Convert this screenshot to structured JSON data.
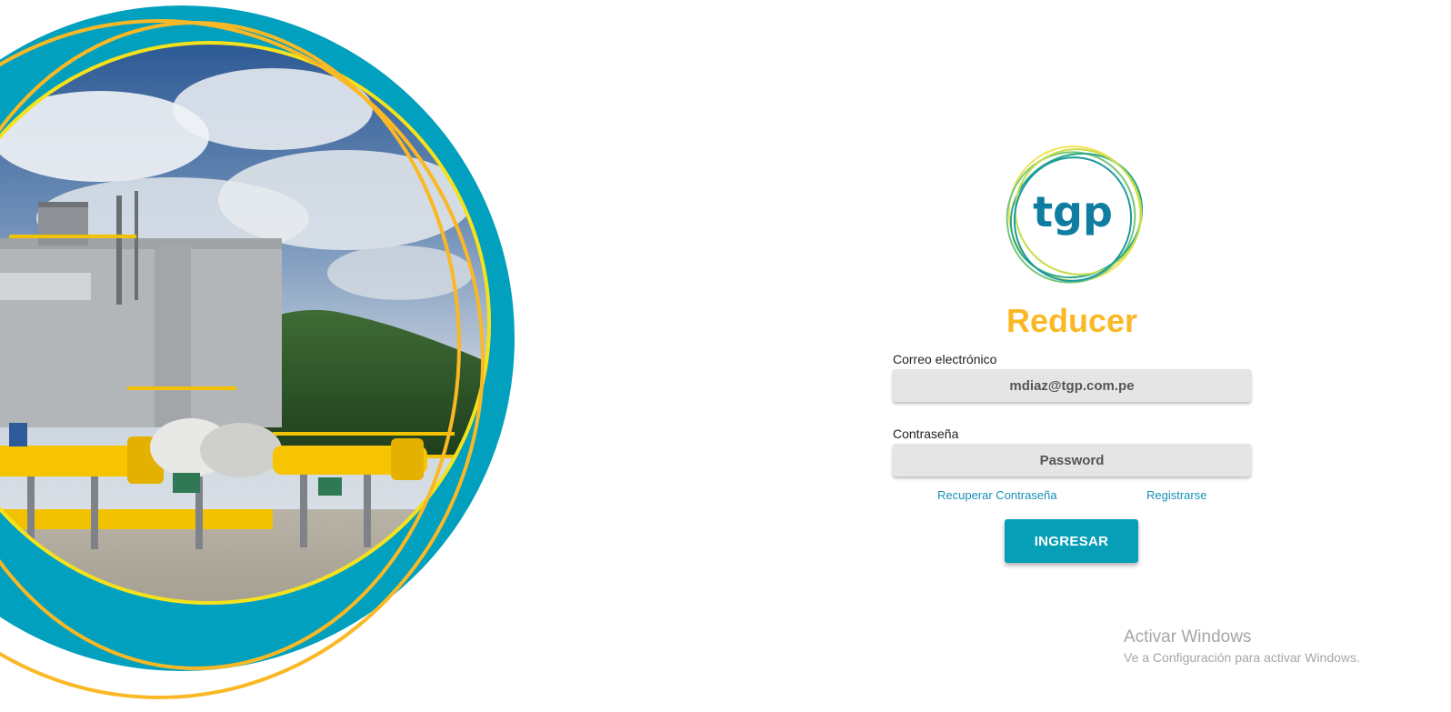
{
  "hero": {
    "image_alt": "Industrial gas plant with yellow pipelines under a cloudy sky",
    "colors": {
      "ring_teal": "#00a0be",
      "ring_yellow": "#fbb825",
      "ring_lime": "#f4e21c"
    }
  },
  "brand": {
    "logo_text": "tgp",
    "logo_text_color": "#0f7da2",
    "app_title": "Reducer",
    "title_color": "#fbb825"
  },
  "form": {
    "email_label": "Correo electrónico",
    "email_value": "mdiaz@tgp.com.pe",
    "password_label": "Contraseña",
    "password_placeholder": "Password",
    "recover_link": "Recuperar Contraseña",
    "register_link": "Registrarse",
    "submit_label": "INGRESAR",
    "accent_color": "#079eb8"
  },
  "watermark": {
    "title": "Activar Windows",
    "subtitle": "Ve a Configuración para activar Windows."
  }
}
